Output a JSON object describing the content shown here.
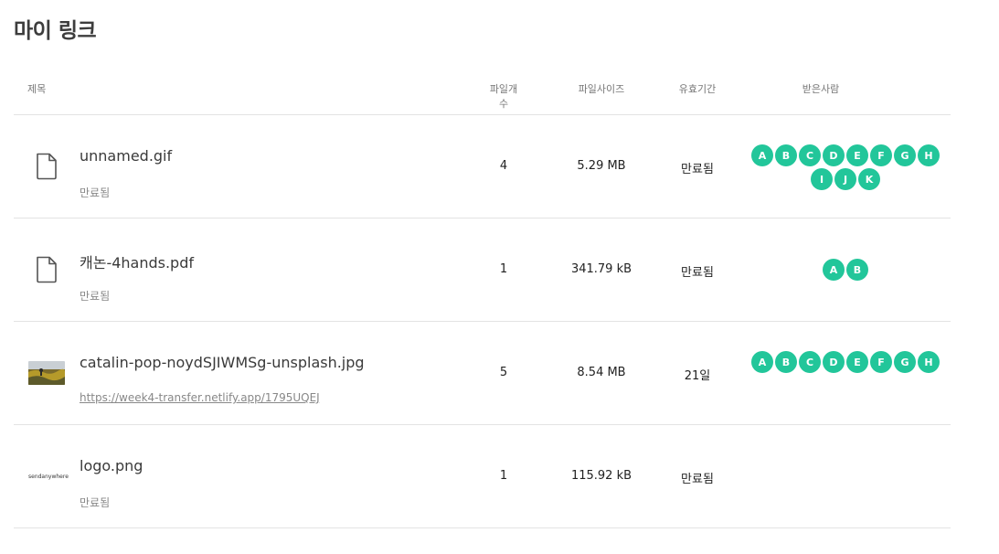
{
  "page": {
    "title": "마이 링크"
  },
  "columns": {
    "title": "제목",
    "file_count": "파일개수",
    "file_size": "파일사이즈",
    "expiry": "유효기간",
    "recipients": "받은사람"
  },
  "rows": [
    {
      "thumbnail": "file-icon",
      "name": "unnamed.gif",
      "sub": "만료됨",
      "file_count": "4",
      "file_size": "5.29 MB",
      "expiry": "만료됨",
      "recipients": [
        "A",
        "B",
        "C",
        "D",
        "E",
        "F",
        "G",
        "H",
        "I",
        "J",
        "K"
      ]
    },
    {
      "thumbnail": "file-icon",
      "name": "캐논-4hands.pdf",
      "sub": "만료됨",
      "file_count": "1",
      "file_size": "341.79 kB",
      "expiry": "만료됨",
      "recipients": [
        "A",
        "B"
      ]
    },
    {
      "thumbnail": "photo-thumbnail",
      "name": "catalin-pop-noydSJIWMSg-unsplash.jpg",
      "sub": "https://week4-transfer.netlify.app/1795UQEJ",
      "file_count": "5",
      "file_size": "8.54 MB",
      "expiry": "21일",
      "recipients": [
        "A",
        "B",
        "C",
        "D",
        "E",
        "F",
        "G",
        "H"
      ]
    },
    {
      "thumbnail": "logo-thumbnail",
      "logo_text": "sendanywhere",
      "name": "logo.png",
      "sub": "만료됨",
      "file_count": "1",
      "file_size": "115.92 kB",
      "expiry": "만료됨",
      "recipients": []
    }
  ],
  "colors": {
    "avatar": "#22c69a",
    "divider": "#e3e3e3"
  }
}
